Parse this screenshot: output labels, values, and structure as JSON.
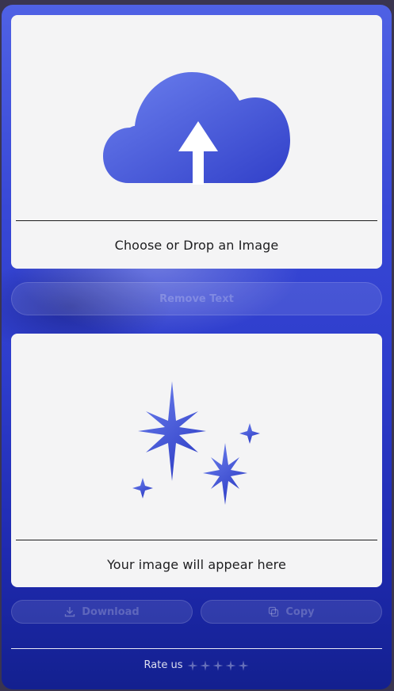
{
  "upload": {
    "caption": "Choose or Drop an Image",
    "icon": "cloud-upload-icon"
  },
  "actions": {
    "remove_label": "Remove Text",
    "download_label": "Download",
    "copy_label": "Copy"
  },
  "result": {
    "caption": "Your image will appear here",
    "icon": "sparkles-icon"
  },
  "footer": {
    "rate_label": "Rate us",
    "star_count": 5
  },
  "colors": {
    "accent": "#3f52d8",
    "accent_light": "#6a7ff0",
    "card": "#f4f4f5"
  }
}
